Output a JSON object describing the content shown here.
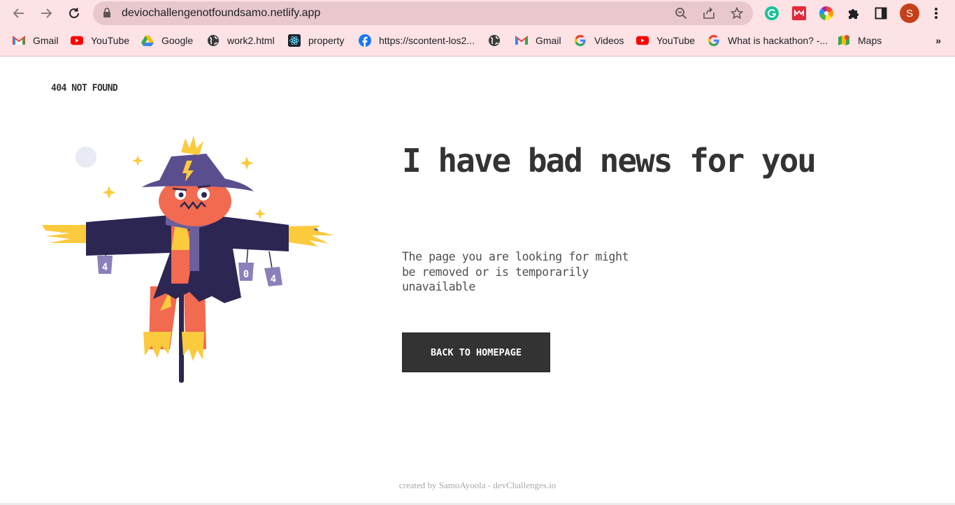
{
  "browser": {
    "url": "deviochallengenotfoundsamo.netlify.app",
    "profile_initial": "S",
    "bookmarks": [
      {
        "label": "Gmail",
        "icon": "gmail-icon"
      },
      {
        "label": "YouTube",
        "icon": "youtube-icon"
      },
      {
        "label": "Google",
        "icon": "google-drive-icon"
      },
      {
        "label": "work2.html",
        "icon": "globe-icon"
      },
      {
        "label": "property",
        "icon": "react-icon"
      },
      {
        "label": "https://scontent-los2...",
        "icon": "facebook-icon"
      },
      {
        "label": "",
        "icon": "globe-icon"
      },
      {
        "label": "Gmail",
        "icon": "gmail-icon"
      },
      {
        "label": "Videos",
        "icon": "google-icon"
      },
      {
        "label": "YouTube",
        "icon": "youtube-icon"
      },
      {
        "label": "What is hackathon? -...",
        "icon": "google-icon"
      },
      {
        "label": "Maps",
        "icon": "maps-icon"
      }
    ],
    "more_bookmarks": "»"
  },
  "page": {
    "brand": "404 NOT FOUND",
    "headline": "I have bad news for you",
    "subtext": "The page you are looking for might be removed or is temporarily unavailable",
    "cta_label": "BACK TO HOMEPAGE",
    "footer": "created by SamoAyoola - devChallenges.io",
    "illustration": {
      "name": "scarecrow-illustration",
      "can_labels": [
        "4",
        "0",
        "4"
      ]
    }
  },
  "colors": {
    "chrome_bg": "#fde2e6",
    "omnibox_bg": "#e8c8cd",
    "text_dark": "#333333",
    "button_bg": "#333333",
    "hat": "#5b4e8e",
    "coat": "#2c2653",
    "face": "#f26a4f",
    "straw": "#fcca3d"
  }
}
